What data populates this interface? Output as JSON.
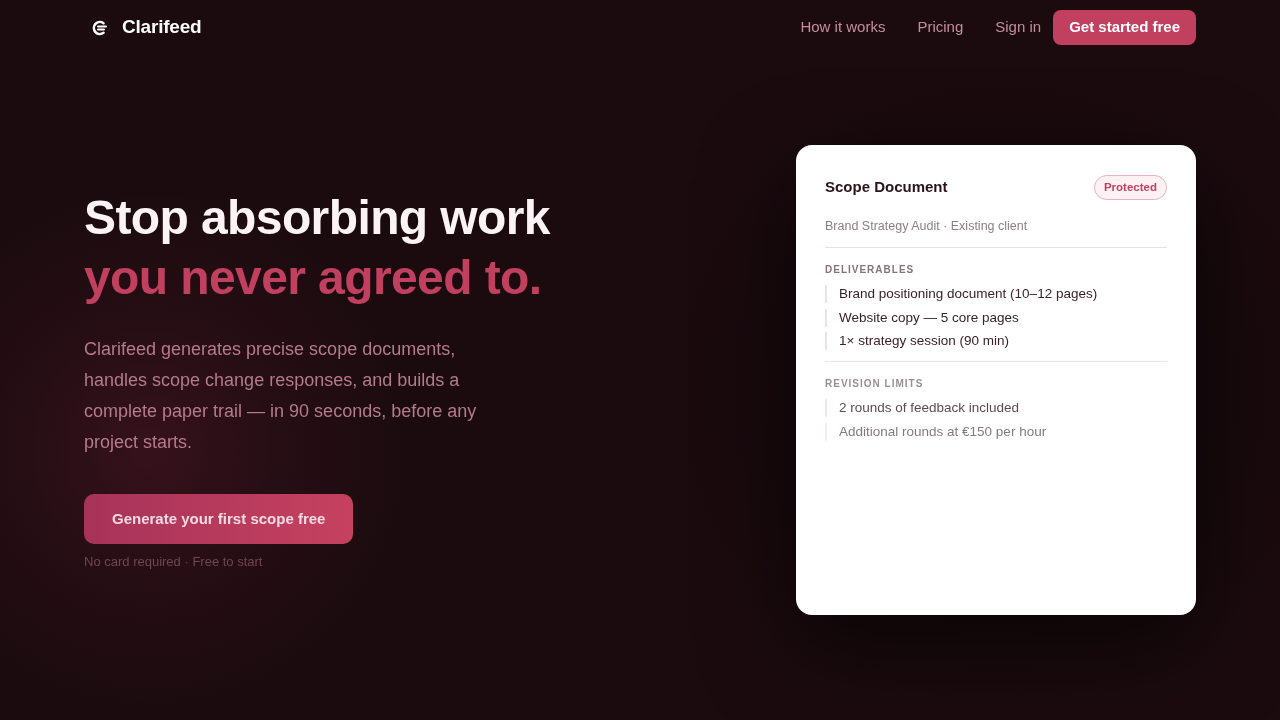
{
  "nav": {
    "brand": "Clarifeed",
    "links": [
      {
        "label": "How it works"
      },
      {
        "label": "Pricing"
      },
      {
        "label": "Sign in"
      }
    ],
    "cta": "Get started free"
  },
  "hero": {
    "headline": "Stop absorbing work",
    "headline_accent": "you never agreed to.",
    "description": "Clarifeed generates precise scope documents, handles scope change responses, and builds a complete paper trail — in 90 seconds, before any project starts.",
    "cta": "Generate your first scope free",
    "note": "No card required · Free to start"
  },
  "scope_card": {
    "title": "Scope Document",
    "badge": "Protected",
    "subtitle": "Brand Strategy Audit · Existing client",
    "sections": [
      {
        "heading": "DELIVERABLES",
        "faded": false,
        "items": [
          {
            "text": "Brand positioning document (10–12 pages)",
            "faded": false
          },
          {
            "text": "Website copy — 5 core pages",
            "faded": false
          },
          {
            "text": "1× strategy session (90 min)",
            "faded": false
          }
        ]
      },
      {
        "heading": "REVISION LIMITS",
        "faded": true,
        "items": [
          {
            "text": "2 rounds of feedback included",
            "faded": false
          },
          {
            "text": "Additional rounds at €150 per hour",
            "faded": true
          }
        ]
      }
    ]
  }
}
